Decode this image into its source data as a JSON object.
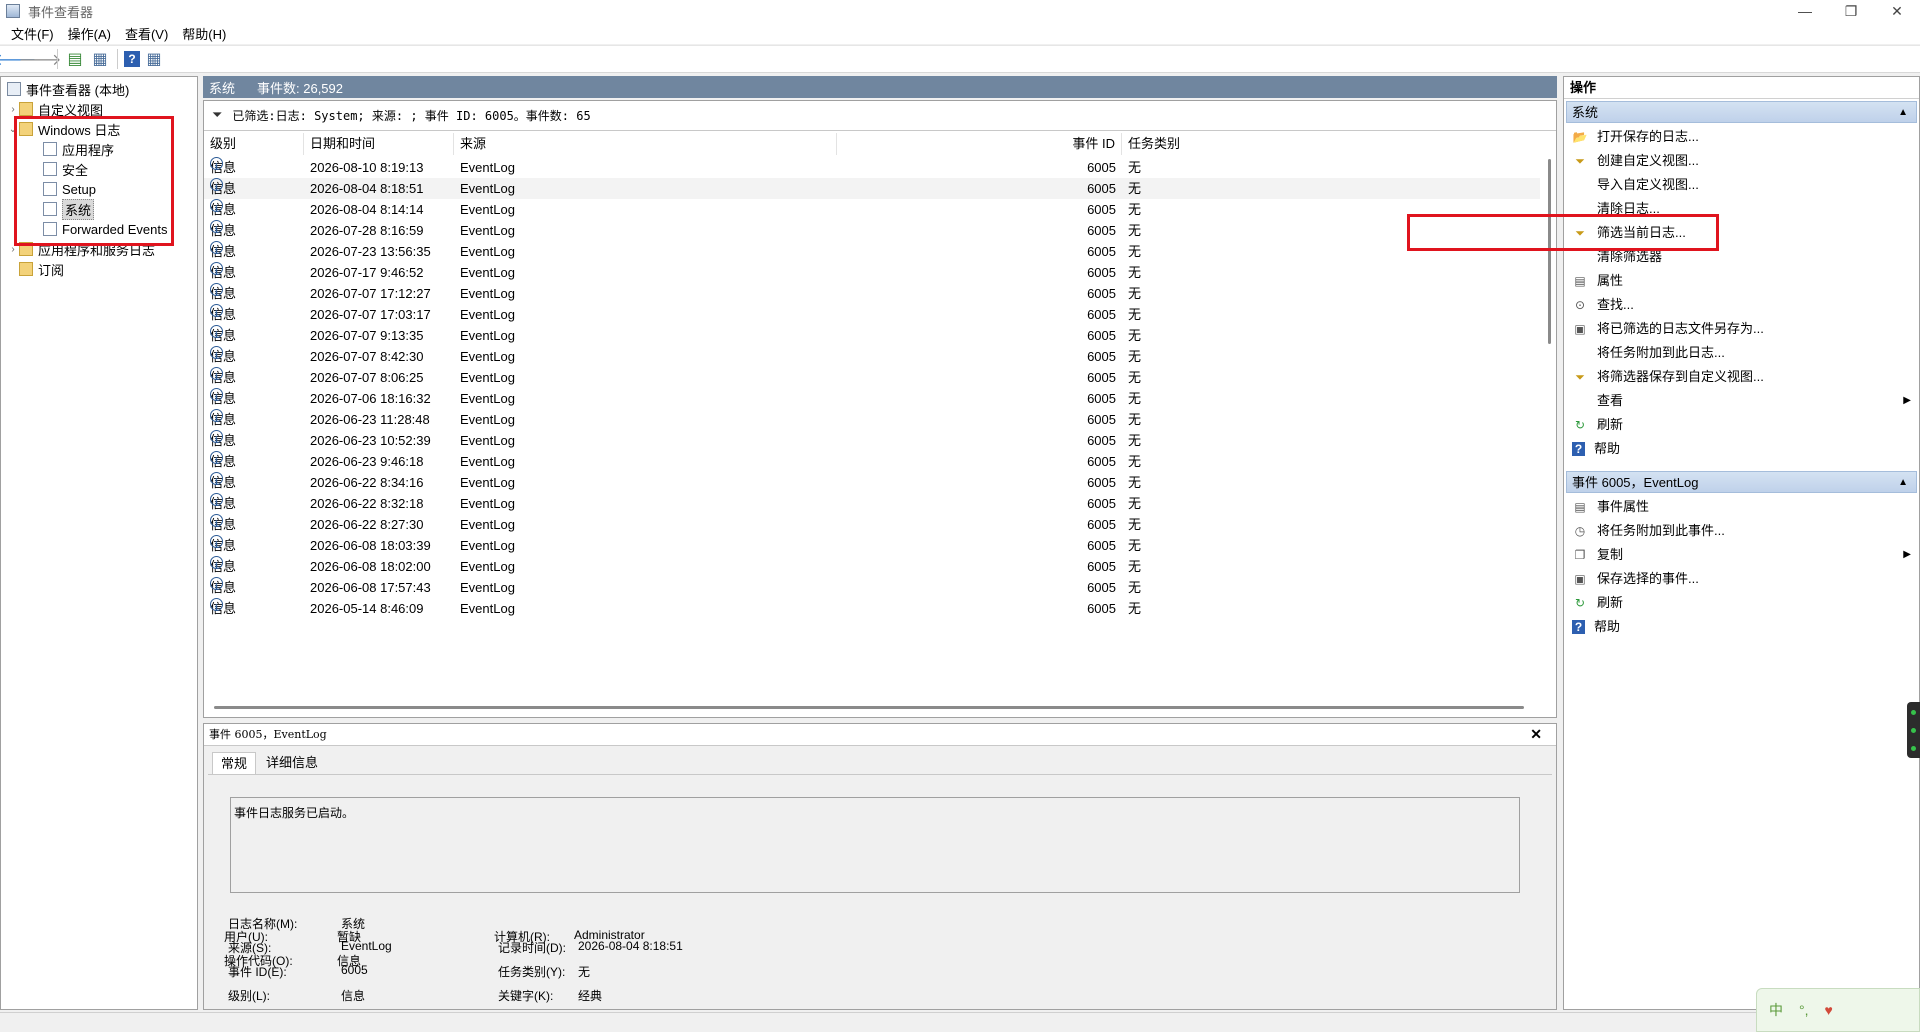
{
  "window": {
    "title": "事件查看器",
    "min": "—",
    "max": "❐",
    "close": "✕"
  },
  "menu": [
    "文件(F)",
    "操作(A)",
    "查看(V)",
    "帮助(H)"
  ],
  "tree": {
    "root": "事件查看器 (本地)",
    "custom_views": "自定义视图",
    "windows_logs": "Windows 日志",
    "children": [
      "应用程序",
      "安全",
      "Setup",
      "系统",
      "Forwarded Events"
    ],
    "app_service_logs": "应用程序和服务日志",
    "subscriptions": "订阅",
    "selected": "系统"
  },
  "center": {
    "log_name": "系统",
    "event_count": "事件数: 26,592",
    "filter_text": "已筛选:日志: System; 来源: ; 事件 ID: 6005。事件数: 65",
    "columns": [
      "级别",
      "日期和时间",
      "来源",
      "事件 ID",
      "任务类别"
    ],
    "rows": [
      {
        "level": "信息",
        "date": "2026-08-10 8:19:13",
        "source": "EventLog",
        "id": "6005",
        "task": "无"
      },
      {
        "level": "信息",
        "date": "2026-08-04 8:18:51",
        "source": "EventLog",
        "id": "6005",
        "task": "无"
      },
      {
        "level": "信息",
        "date": "2026-08-04 8:14:14",
        "source": "EventLog",
        "id": "6005",
        "task": "无"
      },
      {
        "level": "信息",
        "date": "2026-07-28 8:16:59",
        "source": "EventLog",
        "id": "6005",
        "task": "无"
      },
      {
        "level": "信息",
        "date": "2026-07-23 13:56:35",
        "source": "EventLog",
        "id": "6005",
        "task": "无"
      },
      {
        "level": "信息",
        "date": "2026-07-17 9:46:52",
        "source": "EventLog",
        "id": "6005",
        "task": "无"
      },
      {
        "level": "信息",
        "date": "2026-07-07 17:12:27",
        "source": "EventLog",
        "id": "6005",
        "task": "无"
      },
      {
        "level": "信息",
        "date": "2026-07-07 17:03:17",
        "source": "EventLog",
        "id": "6005",
        "task": "无"
      },
      {
        "level": "信息",
        "date": "2026-07-07 9:13:35",
        "source": "EventLog",
        "id": "6005",
        "task": "无"
      },
      {
        "level": "信息",
        "date": "2026-07-07 8:42:30",
        "source": "EventLog",
        "id": "6005",
        "task": "无"
      },
      {
        "level": "信息",
        "date": "2026-07-07 8:06:25",
        "source": "EventLog",
        "id": "6005",
        "task": "无"
      },
      {
        "level": "信息",
        "date": "2026-07-06 18:16:32",
        "source": "EventLog",
        "id": "6005",
        "task": "无"
      },
      {
        "level": "信息",
        "date": "2026-06-23 11:28:48",
        "source": "EventLog",
        "id": "6005",
        "task": "无"
      },
      {
        "level": "信息",
        "date": "2026-06-23 10:52:39",
        "source": "EventLog",
        "id": "6005",
        "task": "无"
      },
      {
        "level": "信息",
        "date": "2026-06-23 9:46:18",
        "source": "EventLog",
        "id": "6005",
        "task": "无"
      },
      {
        "level": "信息",
        "date": "2026-06-22 8:34:16",
        "source": "EventLog",
        "id": "6005",
        "task": "无"
      },
      {
        "level": "信息",
        "date": "2026-06-22 8:32:18",
        "source": "EventLog",
        "id": "6005",
        "task": "无"
      },
      {
        "level": "信息",
        "date": "2026-06-22 8:27:30",
        "source": "EventLog",
        "id": "6005",
        "task": "无"
      },
      {
        "level": "信息",
        "date": "2026-06-08 18:03:39",
        "source": "EventLog",
        "id": "6005",
        "task": "无"
      },
      {
        "level": "信息",
        "date": "2026-06-08 18:02:00",
        "source": "EventLog",
        "id": "6005",
        "task": "无"
      },
      {
        "level": "信息",
        "date": "2026-06-08 17:57:43",
        "source": "EventLog",
        "id": "6005",
        "task": "无"
      },
      {
        "level": "信息",
        "date": "2026-05-14 8:46:09",
        "source": "EventLog",
        "id": "6005",
        "task": "无"
      }
    ],
    "selected_row": 1
  },
  "detail": {
    "title": "事件 6005，EventLog",
    "close": "✕",
    "tabs": [
      "常规",
      "详细信息"
    ],
    "description": "事件日志服务已启动。",
    "fields": {
      "log_name_label": "日志名称(M):",
      "log_name": "系统",
      "source_label": "来源(S):",
      "source": "EventLog",
      "logged_label": "记录时间(D):",
      "logged": "2026-08-04 8:18:51",
      "event_id_label": "事件 ID(E):",
      "event_id": "6005",
      "task_label": "任务类别(Y):",
      "task": "无",
      "level_label": "级别(L):",
      "level": "信息",
      "keywords_label": "关键字(K):",
      "keywords": "经典",
      "user_label": "用户(U):",
      "user": "暂缺",
      "computer_label": "计算机(R):",
      "computer": "Administrator",
      "opcode_label": "操作代码(O):",
      "opcode": "信息"
    }
  },
  "actions": {
    "title": "操作",
    "section1": "系统",
    "section1_items": [
      {
        "label": "打开保存的日志...",
        "icon": "folder-open-icon"
      },
      {
        "label": "创建自定义视图...",
        "icon": "filter-create-icon"
      },
      {
        "label": "导入自定义视图...",
        "icon": ""
      },
      {
        "label": "清除日志...",
        "icon": ""
      },
      {
        "label": "筛选当前日志...",
        "icon": "filter-icon"
      },
      {
        "label": "清除筛选器",
        "icon": ""
      },
      {
        "label": "属性",
        "icon": "properties-icon"
      },
      {
        "label": "查找...",
        "icon": "binoculars-icon"
      },
      {
        "label": "将已筛选的日志文件另存为...",
        "icon": "save-icon"
      },
      {
        "label": "将任务附加到此日志...",
        "icon": ""
      },
      {
        "label": "将筛选器保存到自定义视图...",
        "icon": "filter-save-icon"
      },
      {
        "label": "查看",
        "icon": "",
        "submenu": "▶"
      },
      {
        "label": "刷新",
        "icon": "refresh-icon"
      },
      {
        "label": "帮助",
        "icon": "help-icon"
      }
    ],
    "section2": "事件 6005，EventLog",
    "section2_items": [
      {
        "label": "事件属性",
        "icon": "properties-icon"
      },
      {
        "label": "将任务附加到此事件...",
        "icon": "task-icon"
      },
      {
        "label": "复制",
        "icon": "copy-icon",
        "submenu": "▶"
      },
      {
        "label": "保存选择的事件...",
        "icon": "save-icon"
      },
      {
        "label": "刷新",
        "icon": "refresh-icon"
      },
      {
        "label": "帮助",
        "icon": "help-icon"
      }
    ]
  },
  "ime": {
    "mode": "中",
    "punct": "°,"
  },
  "colors": {
    "center_header": "#70869f",
    "annotation": "#e0141e",
    "section_bg": "#c8d8ee"
  }
}
